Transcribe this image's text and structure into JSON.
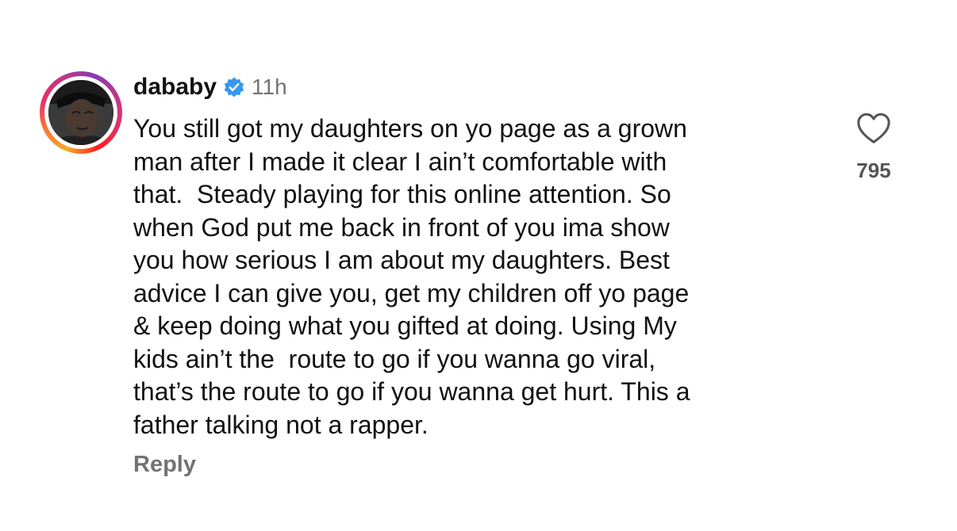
{
  "comment": {
    "username": "dababy",
    "verified": true,
    "timestamp": "11h",
    "text_lines": [
      "You still got my daughters on yo page as a grown",
      "man after I made it clear I ain’t comfortable with",
      "that.  Steady playing for this online attention. So",
      "when God put me back in front of you ima show",
      "you how serious I am about my daughters. Best",
      "advice I can give you, get my children off yo page",
      "& keep doing what you gifted at doing. Using My",
      "kids ain’t the  route to go if you wanna go viral,",
      "that’s the route to go if you wanna get hurt. This a",
      "father talking not a rapper."
    ],
    "reply_label": "Reply",
    "like_count": "795"
  },
  "icons": {
    "avatar": "avatar",
    "verified": "verified-badge-icon",
    "like": "heart-outline-icon"
  },
  "colors": {
    "verified_blue": "#3897f0",
    "secondary_text": "#737373"
  }
}
